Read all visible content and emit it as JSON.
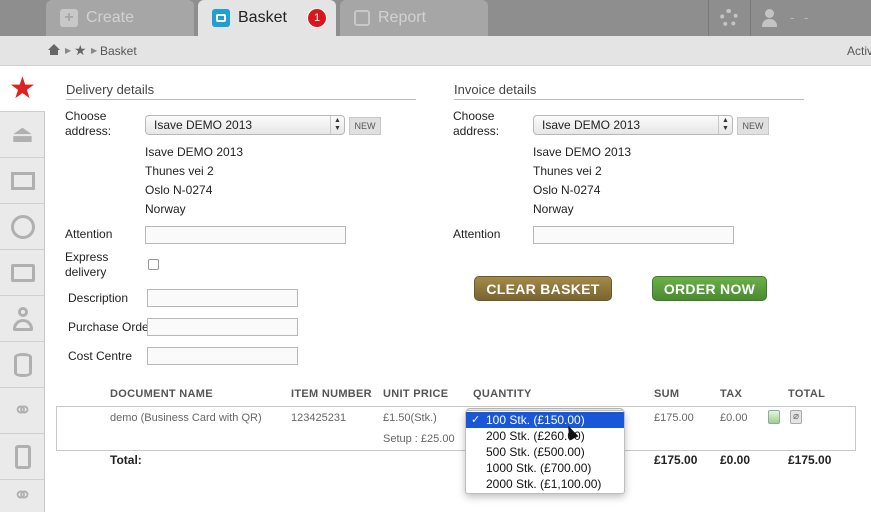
{
  "tabs": {
    "create": "Create",
    "basket": "Basket",
    "basket_badge": "1",
    "report": "Report"
  },
  "header": {
    "user_name": "- -"
  },
  "breadcrumb": {
    "current": "Basket",
    "right_text": "Activ"
  },
  "sidebar": {
    "icons": [
      "star-icon",
      "inbox-tray-icon",
      "mail-icon",
      "globe-icon",
      "folder-icon",
      "person-icon",
      "cylinder-icon",
      "network-icon",
      "phone-icon",
      "network-icon"
    ]
  },
  "delivery": {
    "title": "Delivery details",
    "choose_label": "Choose address:",
    "selected_address": "Isave DEMO 2013",
    "new_label": "NEW",
    "address_lines": [
      "Isave DEMO 2013",
      "Thunes vei 2",
      "Oslo N-0274",
      "Norway"
    ],
    "attention_label": "Attention",
    "express_label": "Express delivery",
    "description_label": "Description",
    "purchase_order_label": "Purchase Order",
    "cost_centre_label": "Cost Centre"
  },
  "invoice": {
    "title": "Invoice details",
    "choose_label": "Choose address:",
    "selected_address": "Isave DEMO 2013",
    "new_label": "NEW",
    "address_lines": [
      "Isave DEMO 2013",
      "Thunes vei 2",
      "Oslo N-0274",
      "Norway"
    ],
    "attention_label": "Attention"
  },
  "actions": {
    "clear_basket": "CLEAR BASKET",
    "order_now": "ORDER NOW"
  },
  "table": {
    "headers": {
      "document_name": "DOCUMENT NAME",
      "item_number": "ITEM NUMBER",
      "unit_price": "UNIT PRICE",
      "quantity": "QUANTITY",
      "sum": "SUM",
      "tax": "TAX",
      "total": "TOTAL"
    },
    "row": {
      "document_name": "demo (Business Card with QR)",
      "item_number": "123425231",
      "unit_price": "£1.50(Stk.)",
      "setup": "Setup : £25.00",
      "sum": "£175.00",
      "tax": "£0.00"
    },
    "quantity_options": [
      "100 Stk. (£150.00)",
      "200 Stk. (£260.00)",
      "500 Stk. (£500.00)",
      "1000 Stk. (£700.00)",
      "2000 Stk. (£1,100.00)"
    ],
    "selected_quantity_index": 0,
    "check_mark": "✓",
    "totals": {
      "label": "Total:",
      "sum": "£175.00",
      "tax": "£0.00",
      "total": "£175.00"
    }
  }
}
